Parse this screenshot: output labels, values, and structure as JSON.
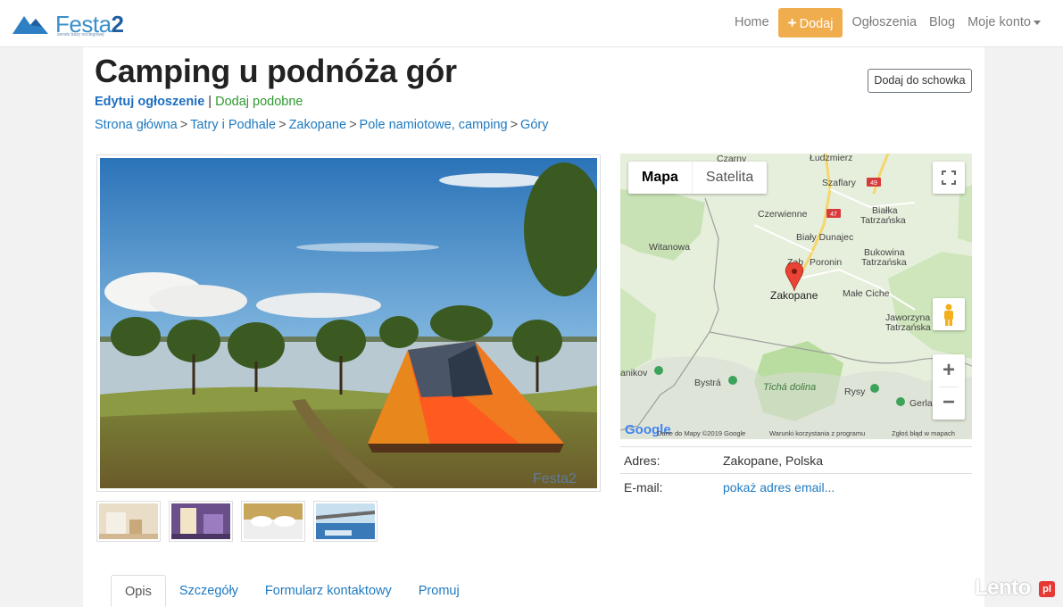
{
  "brand": {
    "name": "Festa",
    "name_suffix": "2",
    "tagline": "serwis bazy noclegowej"
  },
  "nav": {
    "home": "Home",
    "add": "Dodaj",
    "listings": "Ogłoszenia",
    "blog": "Blog",
    "account": "Moje konto"
  },
  "page": {
    "title": "Camping u podnóża gór",
    "edit_link": "Edytuj ogłoszenie",
    "separator": "|",
    "similar_link": "Dodaj podobne",
    "clipboard_button": "Dodaj do schowka"
  },
  "breadcrumb": {
    "items": [
      "Strona główna",
      "Tatry i Podhale",
      "Zakopane",
      "Pole namiotowe, camping",
      "Góry"
    ],
    "separator": ">"
  },
  "photo": {
    "watermark": "Festa2"
  },
  "map": {
    "tab_map": "Mapa",
    "tab_satellite": "Satelita",
    "labels": {
      "czarny": "Czarny",
      "ludzmierz": "Łudzmierz",
      "szaflary": "Szaflary",
      "czerwienne": "Czerwienne",
      "bialka": "Białka",
      "tatrzanska": "Tatrzańska",
      "bialy_dunajec": "Biały Dunajec",
      "witanowa": "Witanowa",
      "bukowina": "Bukowina",
      "bukowina_2": "Tatrzańska",
      "zab": "Ząb",
      "poronin": "Poronin",
      "zakopane": "Zakopane",
      "male_ciche": "Małe Ciche",
      "jaworzyna": "Jaworzyna",
      "jaworzyna_2": "Tatrzańska",
      "nikov": "anikov",
      "bystra": "Bystrá",
      "ticha_dolina": "Tichá dolina",
      "rysy": "Rysy",
      "gerla": "Gerla",
      "road_49": "49",
      "road_47": "47"
    },
    "footer_data": "Dane do Mapy ©2019 Google",
    "footer_terms": "Warunki korzystania z programu",
    "footer_report": "Zgłoś błąd w mapach",
    "google": "Google",
    "zoom_in": "+",
    "zoom_out": "−"
  },
  "info": {
    "address_label": "Adres:",
    "address_value": "Zakopane, Polska",
    "email_label": "E-mail:",
    "email_value": "pokaż adres email..."
  },
  "tabs": [
    "Opis",
    "Szczegóły",
    "Formularz kontaktowy",
    "Promuj"
  ],
  "watermark": {
    "text": "Lento",
    "badge": "pl"
  },
  "colors": {
    "accent_orange": "#f0ad4e",
    "link_blue": "#1f7ac0",
    "similar_green": "#2f9a2f",
    "marker_red": "#ea4335"
  }
}
